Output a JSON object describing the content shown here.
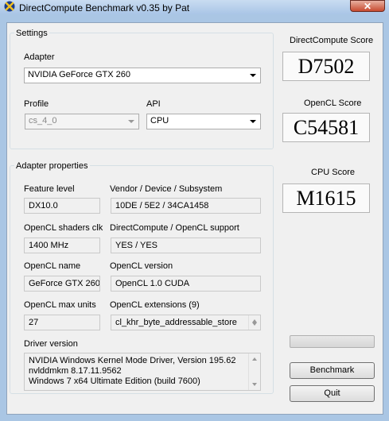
{
  "window": {
    "title": "DirectCompute Benchmark v0.35 by Pat",
    "close_label": "✕"
  },
  "settings": {
    "group_label": "Settings",
    "adapter_label": "Adapter",
    "adapter_value": "NVIDIA GeForce GTX 260",
    "profile_label": "Profile",
    "profile_value": "cs_4_0",
    "api_label": "API",
    "api_value": "CPU"
  },
  "adapter_properties": {
    "group_label": "Adapter properties",
    "feature_level_label": "Feature level",
    "feature_level_value": "DX10.0",
    "vendor_label": "Vendor / Device / Subsystem",
    "vendor_value": "10DE / 5E2 / 34CA1458",
    "shaders_clk_label": "OpenCL shaders clk",
    "shaders_clk_value": "1400 MHz",
    "dc_support_label": "DirectCompute / OpenCL support",
    "dc_support_value": "YES / YES",
    "ocl_name_label": "OpenCL name",
    "ocl_name_value": "GeForce GTX 260",
    "ocl_version_label": "OpenCL version",
    "ocl_version_value": "OpenCL 1.0 CUDA",
    "max_units_label": "OpenCL max units",
    "max_units_value": "27",
    "extensions_label": "OpenCL extensions (9)",
    "extensions_value": "cl_khr_byte_addressable_store",
    "driver_label": "Driver version",
    "driver_lines": [
      "NVIDIA Windows Kernel Mode Driver, Version 195.62",
      "nvlddmkm 8.17.11.9562",
      "Windows 7 x64 Ultimate Edition (build 7600)"
    ]
  },
  "scores": {
    "directcompute_label": "DirectCompute Score",
    "directcompute_value": "D7502",
    "opencl_label": "OpenCL Score",
    "opencl_value": "C54581",
    "cpu_label": "CPU Score",
    "cpu_value": "M1615"
  },
  "progress": {
    "value": 0
  },
  "buttons": {
    "benchmark": "Benchmark",
    "quit": "Quit"
  },
  "icons": {
    "app": "directcompute-x-icon",
    "dropdown": "chevron-down-icon"
  }
}
